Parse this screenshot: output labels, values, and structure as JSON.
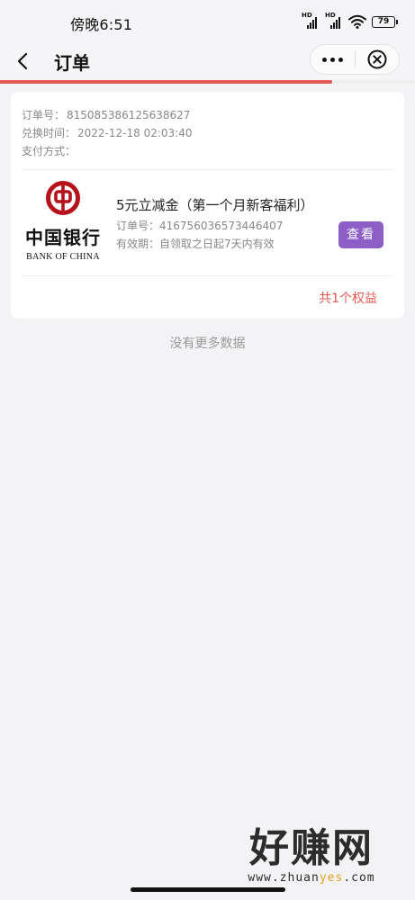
{
  "status_bar": {
    "time": "傍晚6:51",
    "battery": "79"
  },
  "nav": {
    "title": "订单"
  },
  "load_progress": 0.8,
  "order": {
    "order_no_label": "订单号：",
    "order_no": "815085386125638627",
    "redeem_time_label": "兑换时间：",
    "redeem_time": "2022-12-18 02:03:40",
    "payment_label": "支付方式：",
    "payment": "",
    "logo": {
      "cn": "中国银行",
      "en": "BANK OF CHINA"
    },
    "item": {
      "title": "5元立减金（第一个月新客福利）",
      "order_no_label": "订单号：",
      "order_no": "416756036573446407",
      "validity_label": "有效期：",
      "validity": "自领取之日起7天内有效",
      "view_button": "查看"
    },
    "total": "共1个权益"
  },
  "footer_note": "没有更多数据",
  "watermark": {
    "cn": "好赚网",
    "url_prefix": "www.zhuan",
    "url_accent": "yes",
    "url_suffix": ".com"
  },
  "colors": {
    "accent_red": "#e25b52",
    "button_purple": "#8d5fc6",
    "bank_red": "#b5121b"
  }
}
